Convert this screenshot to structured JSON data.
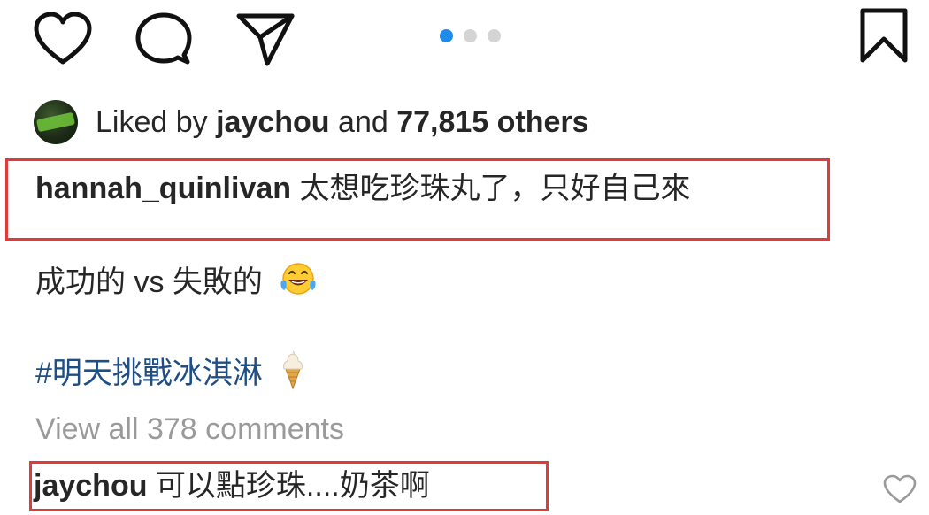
{
  "action_bar": {
    "icons": {
      "like": "heart-icon",
      "comment": "comment-icon",
      "share": "paper-plane-icon",
      "save": "bookmark-icon"
    },
    "pager": {
      "total": 3,
      "active_index": 0
    }
  },
  "likes": {
    "prefix": "Liked by",
    "user": "jaychou",
    "connector": "and",
    "count_text": "77,815 others"
  },
  "caption": {
    "username": "hannah_quinlivan",
    "line1": "太想吃珍珠丸了，只好自己來",
    "line2": "成功的 vs 失敗的",
    "line2_emoji": "tears-of-joy-emoji",
    "hashtag": "#明天挑戰冰淇淋",
    "hashtag_emoji": "ice-cream-emoji"
  },
  "view_all_comments": "View all 378 comments",
  "comment": {
    "username": "jaychou",
    "text": "可以點珍珠....奶茶啊",
    "like_icon": "heart-icon"
  },
  "colors": {
    "text": "#262626",
    "muted": "#9a9a9a",
    "hashtag": "#1e4e86",
    "pager_active": "#1e8ce8",
    "pager_inactive": "#d4d4d4",
    "annotation_red": "#e23a3a"
  }
}
